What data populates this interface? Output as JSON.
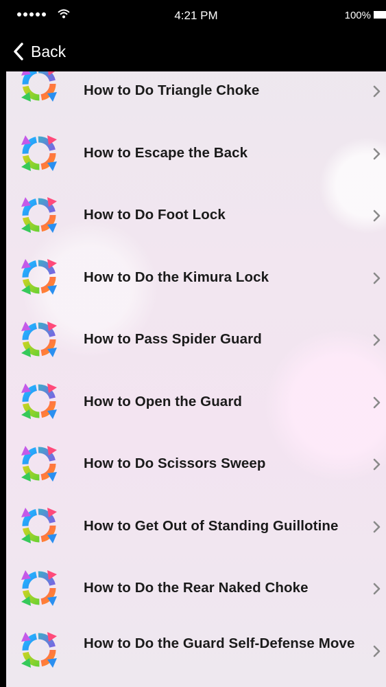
{
  "status_bar": {
    "time": "4:21 PM",
    "battery": "100%",
    "icons": [
      "signal-dots-icon",
      "wifi-icon",
      "battery-icon"
    ]
  },
  "nav": {
    "back_label": "Back",
    "back_icon": "chevron-left-icon"
  },
  "list": {
    "item_icon": "refresh-cycle-icon",
    "item_chevron": "chevron-right-icon",
    "items": [
      {
        "label": "How to Do Triangle Choke"
      },
      {
        "label": "How to Escape the Back"
      },
      {
        "label": "How to Do Foot Lock"
      },
      {
        "label": "How to Do the Kimura Lock"
      },
      {
        "label": "How to Pass Spider Guard"
      },
      {
        "label": "How to Open the Guard"
      },
      {
        "label": "How to Do Scissors Sweep"
      },
      {
        "label": "How to Get Out of Standing Guillotine"
      },
      {
        "label": "How to Do the Rear Naked Choke"
      },
      {
        "label": "How to Do the Guard Self-Defense Move"
      }
    ]
  },
  "colors": {
    "bar_background": "#000000",
    "item_text": "#1a1a1a",
    "chevron": "#8a8a8a"
  }
}
